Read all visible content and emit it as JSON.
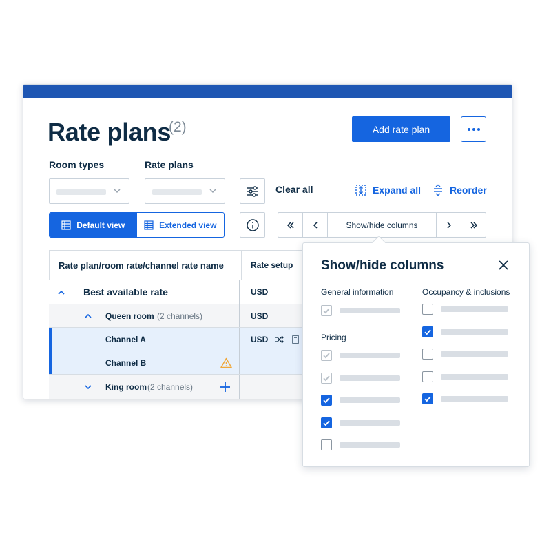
{
  "page": {
    "title": "Rate plans",
    "count": "(2)",
    "add_button": "Add rate plan"
  },
  "filters": {
    "room_types_label": "Room types",
    "rate_plans_label": "Rate plans",
    "clear_all": "Clear all",
    "expand_all": "Expand all",
    "reorder": "Reorder"
  },
  "views": {
    "default": "Default view",
    "extended": "Extended view",
    "selected": "Default view"
  },
  "pager": {
    "center": "Show/hide columns"
  },
  "table": {
    "headers": [
      "Rate plan/room rate/channel rate name",
      "Rate setup"
    ],
    "rows": [
      {
        "name": "Best available rate",
        "setup": "USD"
      },
      {
        "name": "Queen room",
        "sub": "(2 channels)",
        "setup": "USD"
      },
      {
        "name": "Channel A",
        "setup": "USD"
      },
      {
        "name": "Channel B",
        "setup": ""
      },
      {
        "name": "King room",
        "sub": "(2 channels)",
        "setup": ""
      }
    ]
  },
  "popover": {
    "title": "Show/hide columns",
    "groups": {
      "general": "General information",
      "pricing": "Pricing",
      "occupancy": "Occupancy & inclusions"
    },
    "general_items": [
      {
        "state": "disabled-checked"
      }
    ],
    "pricing_items": [
      {
        "state": "disabled-checked"
      },
      {
        "state": "disabled-checked"
      },
      {
        "state": "checked"
      },
      {
        "state": "checked"
      },
      {
        "state": "unchecked"
      }
    ],
    "occupancy_items": [
      {
        "state": "unchecked"
      },
      {
        "state": "checked"
      },
      {
        "state": "unchecked"
      },
      {
        "state": "unchecked"
      },
      {
        "state": "checked"
      }
    ]
  },
  "colors": {
    "primary": "#1565e0",
    "topbar": "#1e56b3",
    "text": "#0f2c45",
    "warning": "#f0a73a"
  }
}
